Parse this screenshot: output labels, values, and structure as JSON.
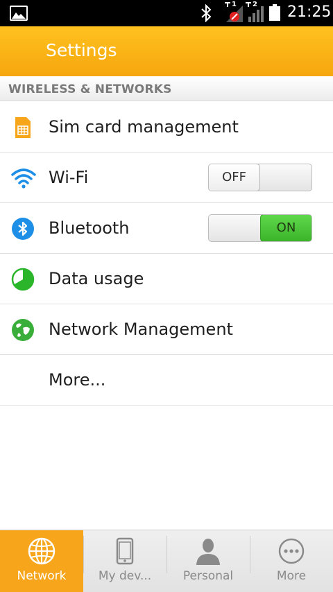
{
  "status_bar": {
    "time": "21:25",
    "sim1_tag": "1",
    "sim2_tag": "2",
    "icons": [
      "gallery-icon",
      "bluetooth-icon",
      "signal-sim1-icon",
      "signal-sim2-icon",
      "battery-icon"
    ]
  },
  "app_bar": {
    "title": "Settings"
  },
  "section": {
    "title": "WIRELESS & NETWORKS"
  },
  "items": [
    {
      "label": "Sim card management",
      "icon": "sim-card-icon"
    },
    {
      "label": "Wi-Fi",
      "icon": "wifi-icon",
      "toggle": "OFF"
    },
    {
      "label": "Bluetooth",
      "icon": "bluetooth-icon",
      "toggle": "ON"
    },
    {
      "label": "Data usage",
      "icon": "data-usage-icon"
    },
    {
      "label": "Network Management",
      "icon": "globe-icon"
    },
    {
      "label": "More..."
    }
  ],
  "bottom_nav": [
    {
      "label": "Network",
      "icon": "globe-icon",
      "active": true
    },
    {
      "label": "My dev...",
      "icon": "phone-icon"
    },
    {
      "label": "Personal",
      "icon": "person-icon"
    },
    {
      "label": "More",
      "icon": "more-icon"
    }
  ],
  "colors": {
    "accent": "#f7a51b",
    "toggle_on": "#3cb42a",
    "icon_blue": "#1e8fe6",
    "icon_green": "#2bb52b"
  }
}
